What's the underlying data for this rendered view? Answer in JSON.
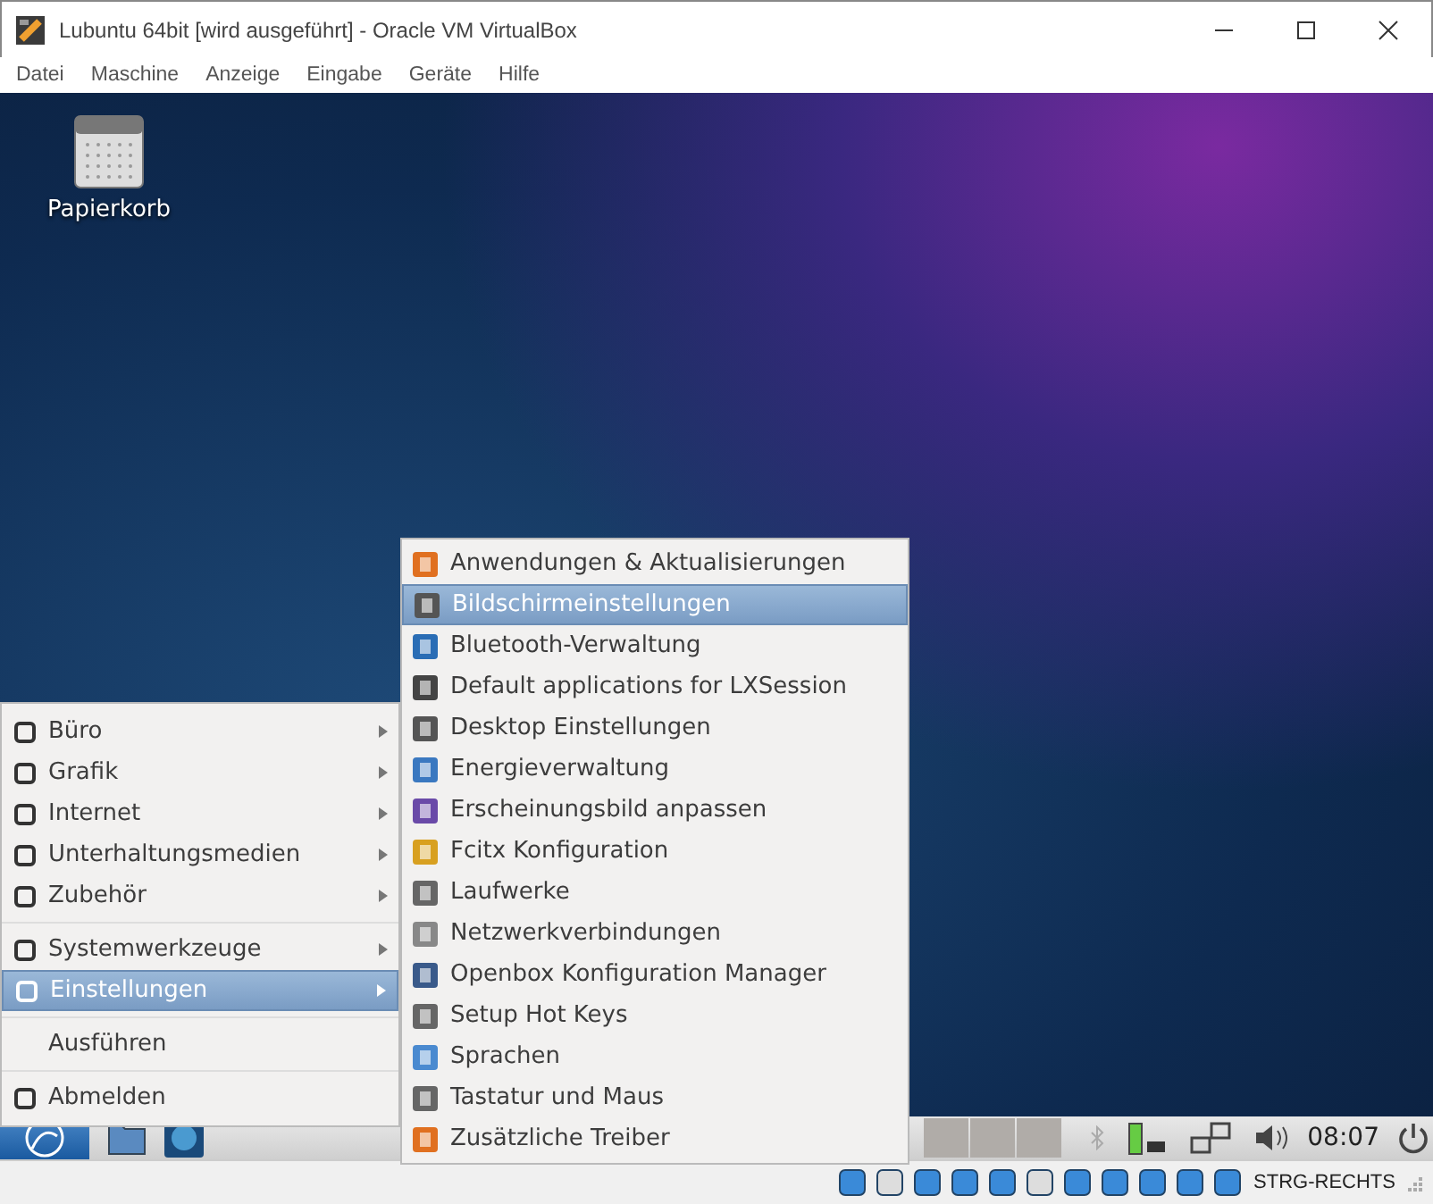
{
  "window": {
    "title": "Lubuntu 64bit [wird ausgeführt] - Oracle VM VirtualBox"
  },
  "menubar": [
    "Datei",
    "Maschine",
    "Anzeige",
    "Eingabe",
    "Geräte",
    "Hilfe"
  ],
  "desktop_icons": [
    {
      "label": "Papierkorb"
    }
  ],
  "main_menu": {
    "groups": [
      [
        {
          "label": "Büro",
          "submenu": true,
          "selected": false
        },
        {
          "label": "Grafik",
          "submenu": true,
          "selected": false
        },
        {
          "label": "Internet",
          "submenu": true,
          "selected": false
        },
        {
          "label": "Unterhaltungsmedien",
          "submenu": true,
          "selected": false
        },
        {
          "label": "Zubehör",
          "submenu": true,
          "selected": false
        }
      ],
      [
        {
          "label": "Systemwerkzeuge",
          "submenu": true,
          "selected": false
        },
        {
          "label": "Einstellungen",
          "submenu": true,
          "selected": true
        }
      ],
      [
        {
          "label": "Ausführen",
          "submenu": false,
          "selected": false
        }
      ],
      [
        {
          "label": "Abmelden",
          "submenu": false,
          "selected": false
        }
      ]
    ]
  },
  "submenu": {
    "items": [
      {
        "label": "Anwendungen & Aktualisierungen",
        "selected": false
      },
      {
        "label": "Bildschirmeinstellungen",
        "selected": true
      },
      {
        "label": "Bluetooth-Verwaltung",
        "selected": false
      },
      {
        "label": "Default applications for LXSession",
        "selected": false
      },
      {
        "label": "Desktop Einstellungen",
        "selected": false
      },
      {
        "label": "Energieverwaltung",
        "selected": false
      },
      {
        "label": "Erscheinungsbild anpassen",
        "selected": false
      },
      {
        "label": "Fcitx Konfiguration",
        "selected": false
      },
      {
        "label": "Laufwerke",
        "selected": false
      },
      {
        "label": "Netzwerkverbindungen",
        "selected": false
      },
      {
        "label": "Openbox Konfiguration Manager",
        "selected": false
      },
      {
        "label": "Setup Hot Keys",
        "selected": false
      },
      {
        "label": "Sprachen",
        "selected": false
      },
      {
        "label": "Tastatur und Maus",
        "selected": false
      },
      {
        "label": "Zusätzliche Treiber",
        "selected": false
      }
    ]
  },
  "taskbar": {
    "clock": "08:07"
  },
  "status_bar": {
    "host_key": "STRG-RECHTS"
  }
}
